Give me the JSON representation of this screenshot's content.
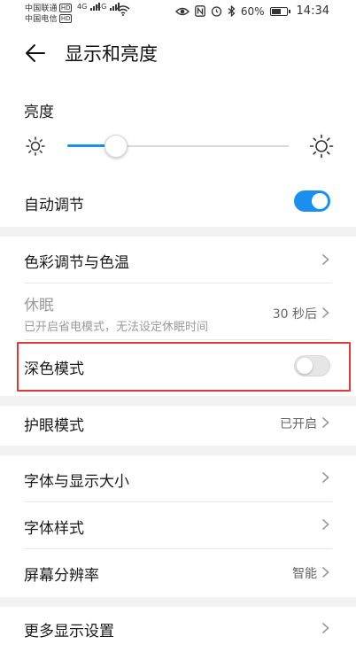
{
  "status_bar": {
    "carrier1": "中国联通",
    "carrier2": "中国电信",
    "hd_badge": "HD",
    "net_type": "4G",
    "battery_percent": "60%",
    "time": "14:34",
    "battery_level": 0.6,
    "icons": [
      "eye-icon",
      "nfc-icon",
      "alarm-icon",
      "bluetooth-icon",
      "wifi-icon",
      "signal-icon",
      "battery-icon"
    ]
  },
  "header": {
    "title": "显示和亮度",
    "back_icon": "back-arrow-icon"
  },
  "brightness": {
    "label": "亮度",
    "level": 0.22,
    "accent": "#1a8ff0"
  },
  "auto_adjust": {
    "label": "自动调节",
    "state": "on"
  },
  "items": {
    "color_temp": {
      "label": "色彩调节与色温"
    },
    "sleep": {
      "label": "休眠",
      "sublabel": "已开启省电模式，无法设定休眠时间",
      "value": "30 秒后"
    },
    "dark_mode": {
      "label": "深色模式",
      "state": "off"
    },
    "eye_comfort": {
      "label": "护眼模式",
      "value": "已开启"
    },
    "font_size": {
      "label": "字体与显示大小"
    },
    "font_style": {
      "label": "字体样式"
    },
    "resolution": {
      "label": "屏幕分辨率",
      "value": "智能"
    },
    "more": {
      "label": "更多显示设置"
    }
  },
  "colors": {
    "toggle_on": "#1a8ff0",
    "highlight": "#e03a3a"
  }
}
